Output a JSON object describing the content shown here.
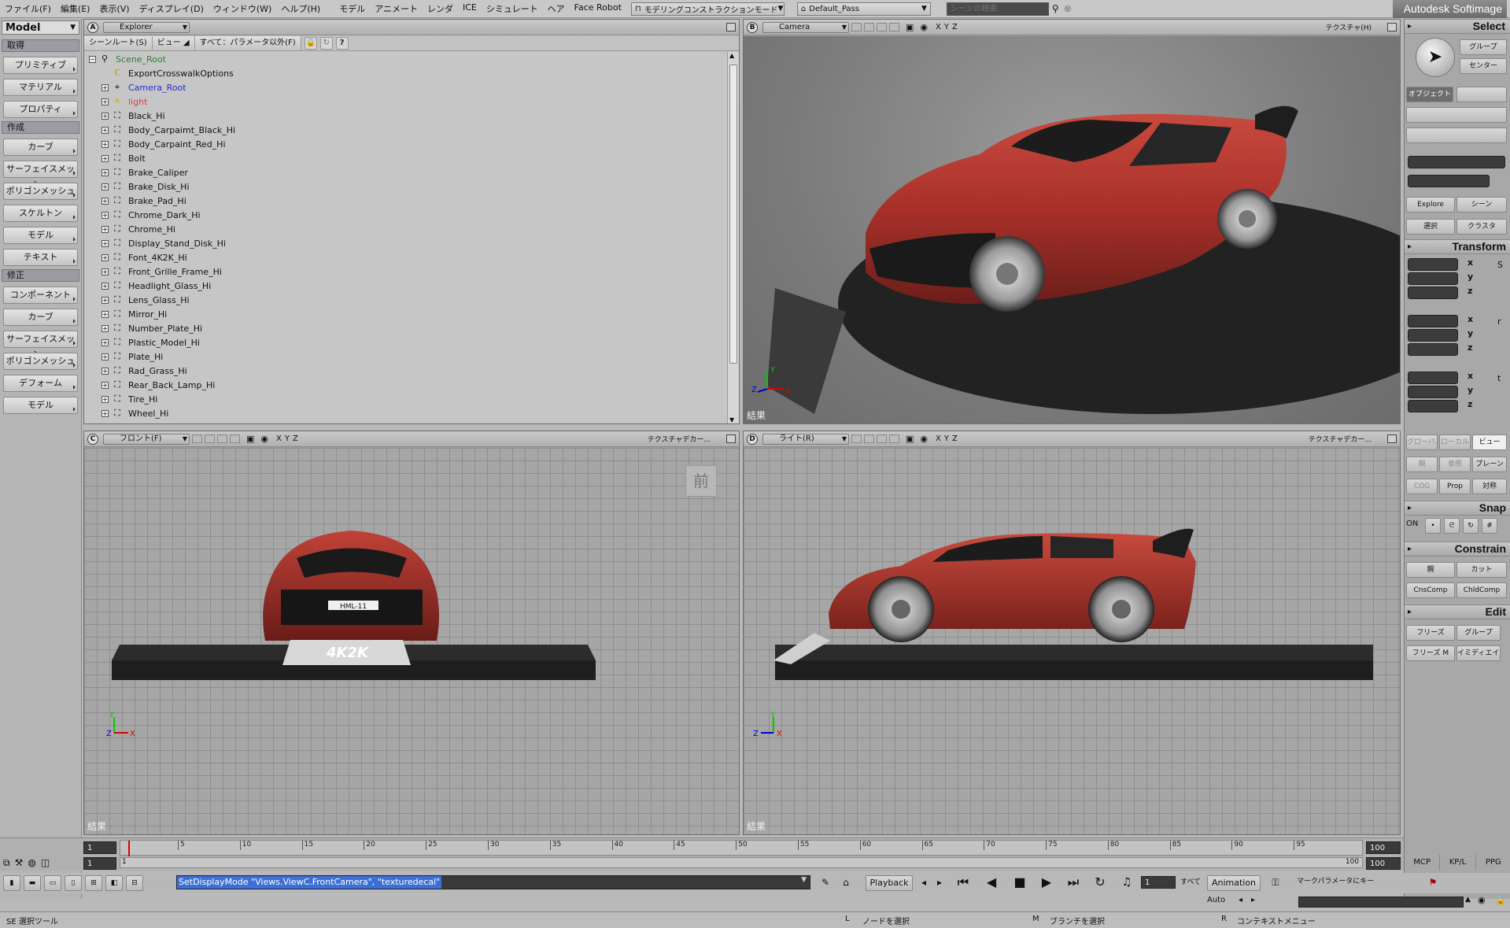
{
  "menubar": {
    "items": [
      "ファイル(F)",
      "編集(E)",
      "表示(V)",
      "ディスプレイ(D)",
      "ウィンドウ(W)",
      "ヘルプ(H)"
    ],
    "items2": [
      "モデル",
      "アニメート",
      "レンダ",
      "ICE",
      "シミュレート",
      "ヘア",
      "Face Robot"
    ],
    "mode": "モデリングコンストラクションモード",
    "pass": "Default_Pass",
    "search_placeholder": "シーンの検索",
    "brand": "Autodesk Softimage"
  },
  "left_toolbar": {
    "mode": "Model",
    "sections": [
      {
        "header": "取得",
        "buttons": [
          "プリミティブ",
          "マテリアル",
          "プロパティ"
        ]
      },
      {
        "header": "作成",
        "buttons": [
          "カーブ",
          "サーフェイスメッシュ",
          "ポリゴンメッシュ",
          "スケルトン",
          "モデル",
          "テキスト"
        ]
      },
      {
        "header": "修正",
        "buttons": [
          "コンポーネント",
          "カーブ",
          "サーフェイスメッシュ",
          "ポリゴンメッシュ",
          "デフォーム",
          "モデル"
        ]
      }
    ]
  },
  "explorer": {
    "letter": "A",
    "title": "Explorer",
    "tabs": [
      "シーンルート(S)",
      "ビュー",
      "すべて：パラメータ以外(F)"
    ],
    "items": [
      {
        "label": "Scene_Root",
        "color": "#2f7f2f",
        "indent": 0,
        "icon": "root"
      },
      {
        "label": "ExportCrosswalkOptions",
        "color": "#111111",
        "indent": 1,
        "icon": "property"
      },
      {
        "label": "Camera_Root",
        "color": "#2a2ad0",
        "indent": 1,
        "icon": "camera"
      },
      {
        "label": "light",
        "color": "#d84040",
        "indent": 1,
        "icon": "light"
      },
      {
        "label": "Black_Hi",
        "color": "#111111",
        "indent": 1,
        "icon": "mesh"
      },
      {
        "label": "Body_Carpaimt_Black_Hi",
        "color": "#111111",
        "indent": 1,
        "icon": "mesh"
      },
      {
        "label": "Body_Carpaint_Red_Hi",
        "color": "#111111",
        "indent": 1,
        "icon": "mesh"
      },
      {
        "label": "Bolt",
        "color": "#111111",
        "indent": 1,
        "icon": "mesh"
      },
      {
        "label": "Brake_Caliper",
        "color": "#111111",
        "indent": 1,
        "icon": "mesh"
      },
      {
        "label": "Brake_Disk_Hi",
        "color": "#111111",
        "indent": 1,
        "icon": "mesh"
      },
      {
        "label": "Brake_Pad_Hi",
        "color": "#111111",
        "indent": 1,
        "icon": "mesh"
      },
      {
        "label": "Chrome_Dark_Hi",
        "color": "#111111",
        "indent": 1,
        "icon": "mesh"
      },
      {
        "label": "Chrome_Hi",
        "color": "#111111",
        "indent": 1,
        "icon": "mesh"
      },
      {
        "label": "Display_Stand_Disk_Hi",
        "color": "#111111",
        "indent": 1,
        "icon": "mesh"
      },
      {
        "label": "Font_4K2K_Hi",
        "color": "#111111",
        "indent": 1,
        "icon": "mesh"
      },
      {
        "label": "Front_Grille_Frame_Hi",
        "color": "#111111",
        "indent": 1,
        "icon": "mesh"
      },
      {
        "label": "Headlight_Glass_Hi",
        "color": "#111111",
        "indent": 1,
        "icon": "mesh"
      },
      {
        "label": "Lens_Glass_Hi",
        "color": "#111111",
        "indent": 1,
        "icon": "mesh"
      },
      {
        "label": "Mirror_Hi",
        "color": "#111111",
        "indent": 1,
        "icon": "mesh"
      },
      {
        "label": "Number_Plate_Hi",
        "color": "#111111",
        "indent": 1,
        "icon": "mesh"
      },
      {
        "label": "Plastic_Model_Hi",
        "color": "#111111",
        "indent": 1,
        "icon": "mesh"
      },
      {
        "label": "Plate_Hi",
        "color": "#111111",
        "indent": 1,
        "icon": "mesh"
      },
      {
        "label": "Rad_Grass_Hi",
        "color": "#111111",
        "indent": 1,
        "icon": "mesh"
      },
      {
        "label": "Rear_Back_Lamp_Hi",
        "color": "#111111",
        "indent": 1,
        "icon": "mesh"
      },
      {
        "label": "Tire_Hi",
        "color": "#111111",
        "indent": 1,
        "icon": "mesh"
      },
      {
        "label": "Wheel_Hi",
        "color": "#111111",
        "indent": 1,
        "icon": "mesh"
      }
    ]
  },
  "viewports": {
    "b": {
      "letter": "B",
      "camera": "Camera",
      "texture": "テクスチャ(H)",
      "result": "結果"
    },
    "c": {
      "letter": "C",
      "camera": "フロント(F)",
      "texture": "テクスチャデカー...",
      "result": "結果",
      "view_badge": "前",
      "plate": "4K2K",
      "number_plate": "HML-11"
    },
    "d": {
      "letter": "D",
      "camera": "ライト(R)",
      "texture": "テクスチャデカー...",
      "result": "結果"
    },
    "axis_labels": {
      "x": "X",
      "y": "Y",
      "z": "Z"
    }
  },
  "right_panel": {
    "select": {
      "title": "Select",
      "group": "グループ",
      "center": "センター",
      "object": "オブジェクト",
      "explore": "Explore",
      "scene": "シーン",
      "sel": "選択",
      "cluster": "クラスタ"
    },
    "transform": {
      "title": "Transform",
      "axes": [
        "x",
        "y",
        "z"
      ],
      "global": "グローバル",
      "local": "ローカル",
      "view": "ビュー",
      "parent": "親",
      "ref": "参照",
      "plane": "プレーン",
      "cog": "COG",
      "prop": "Prop",
      "sym": "対称"
    },
    "snap": {
      "title": "Snap",
      "on": "ON"
    },
    "constrain": {
      "title": "Constrain",
      "parent": "親",
      "cut": "カット",
      "cnscomp": "CnsComp",
      "chldcomp": "ChldComp"
    },
    "edit": {
      "title": "Edit",
      "freeze": "フリーズ",
      "group": "グループ",
      "freeze_m": "フリーズ M",
      "immed": "イミディエイト"
    },
    "bottom_tabs": [
      "MCP",
      "KP/L",
      "PPG"
    ]
  },
  "timeline": {
    "start_frame": "1",
    "current_frame": "1",
    "end_frame": "100",
    "end_frame2": "100",
    "range_end_label": "100",
    "range_start_label": "1",
    "ticks": [
      "5",
      "10",
      "15",
      "20",
      "25",
      "30",
      "35",
      "40",
      "45",
      "50",
      "55",
      "60",
      "65",
      "70",
      "75",
      "80",
      "85",
      "90",
      "95"
    ]
  },
  "commandbar": {
    "command": "SetDisplayMode \"Views.ViewC.FrontCamera\", \"texturedecal\"",
    "playback": "Playback",
    "frame": "1",
    "all": "すべて",
    "animation": "Animation",
    "auto": "Auto",
    "marked_params": "マークパラメータにキー"
  },
  "statusbar": {
    "tool": "SE 選択ツール",
    "l_hint": "ノードを選択",
    "m_hint": "ブランチを選択",
    "r_hint": "コンテキストメニュー"
  }
}
